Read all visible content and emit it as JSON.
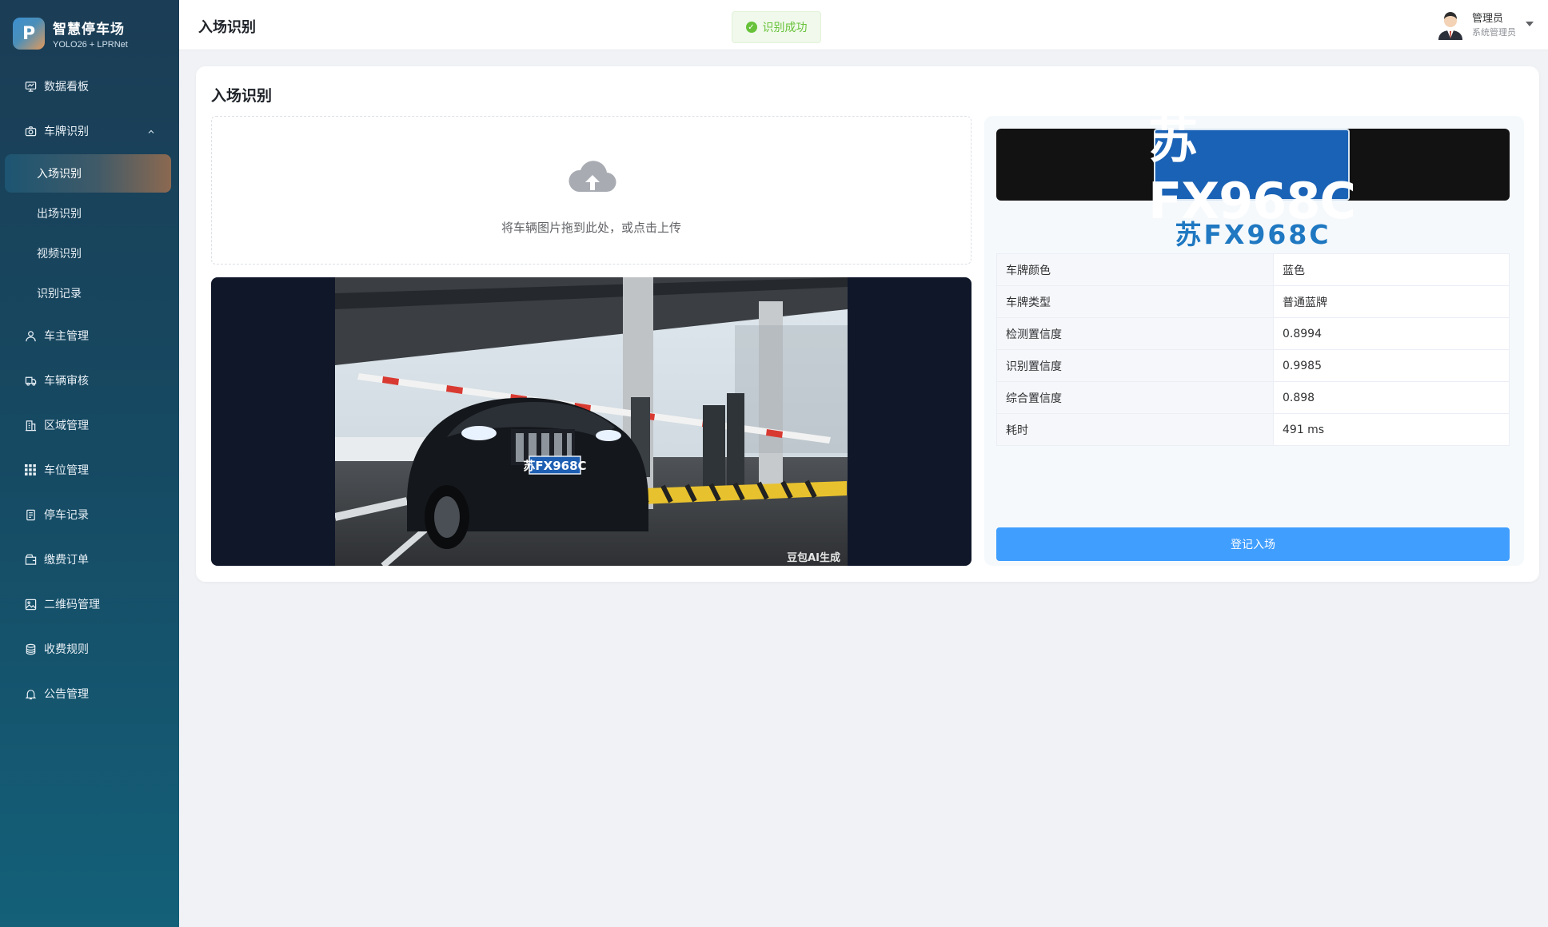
{
  "brand": {
    "logo_letter": "P",
    "title": "智慧停车场",
    "subtitle": "YOLO26 + LPRNet"
  },
  "sidebar": {
    "items": [
      {
        "label": "数据看板",
        "icon": "dashboard-icon"
      },
      {
        "label": "车牌识别",
        "icon": "camera-icon",
        "expanded": true,
        "children": [
          {
            "label": "入场识别",
            "active": true
          },
          {
            "label": "出场识别"
          },
          {
            "label": "视频识别"
          },
          {
            "label": "识别记录"
          }
        ]
      },
      {
        "label": "车主管理",
        "icon": "user-icon"
      },
      {
        "label": "车辆审核",
        "icon": "truck-icon"
      },
      {
        "label": "区域管理",
        "icon": "building-icon"
      },
      {
        "label": "车位管理",
        "icon": "grid-icon"
      },
      {
        "label": "停车记录",
        "icon": "document-icon"
      },
      {
        "label": "缴费订单",
        "icon": "wallet-icon"
      },
      {
        "label": "二维码管理",
        "icon": "image-icon"
      },
      {
        "label": "收费规则",
        "icon": "coins-icon"
      },
      {
        "label": "公告管理",
        "icon": "bell-icon"
      }
    ]
  },
  "header": {
    "title": "入场识别"
  },
  "toast": {
    "message": "识别成功",
    "type": "success",
    "color": "#67c23a"
  },
  "user": {
    "name": "管理员",
    "role": "系统管理员"
  },
  "card": {
    "title": "入场识别"
  },
  "upload": {
    "text": "将车辆图片拖到此处，或点击上传",
    "icon": "cloud-upload-icon"
  },
  "preview": {
    "plate_on_car": "苏FX968C",
    "watermark": "豆包AI生成"
  },
  "result": {
    "plate_image_text": "苏FX968C",
    "plate_number": "苏FX968C",
    "rows": [
      {
        "key": "车牌颜色",
        "value": "蓝色"
      },
      {
        "key": "车牌类型",
        "value": "普通蓝牌"
      },
      {
        "key": "检测置信度",
        "value": "0.8994"
      },
      {
        "key": "识别置信度",
        "value": "0.9985"
      },
      {
        "key": "综合置信度",
        "value": "0.898"
      },
      {
        "key": "耗时",
        "value": "491 ms"
      }
    ],
    "button_label": "登记入场"
  },
  "colors": {
    "primary": "#409eff",
    "plate_blue": "#1a62b5",
    "plate_text": "#1f78c1",
    "sidebar": "#164a63"
  }
}
